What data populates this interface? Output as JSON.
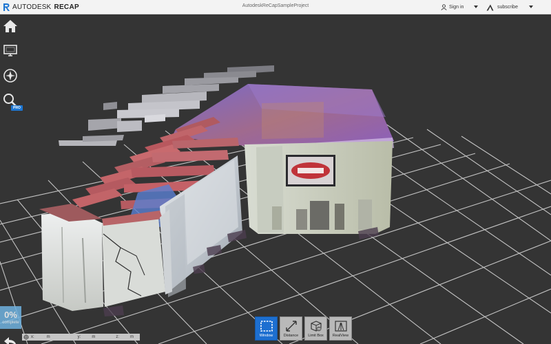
{
  "app": {
    "brand_prefix": "AUTODESK",
    "brand_product": "RECAP",
    "window_title": "AutodeskReCapSampleProject"
  },
  "header": {
    "sign_in_label": "Sign in",
    "subscribe_label": "subscribe"
  },
  "left_toolbar": {
    "items": [
      {
        "icon": "home-icon"
      },
      {
        "icon": "monitor-icon"
      },
      {
        "icon": "navigation-wheel-icon"
      },
      {
        "icon": "search-icon"
      }
    ],
    "pro_badge": "PRO"
  },
  "progress": {
    "value": "0%",
    "label": "complete"
  },
  "coordinates": {
    "x_label": "x:",
    "x_unit": "m",
    "y_label": "y:",
    "y_unit": "m",
    "z_label": "z:",
    "z_unit": "m"
  },
  "bottom_toolbar": {
    "tools": [
      {
        "label": "Window",
        "icon": "window-select-icon",
        "active": true
      },
      {
        "label": "Distance",
        "icon": "distance-measure-icon",
        "active": false
      },
      {
        "label": "Limit Box",
        "icon": "limit-box-icon",
        "active": false
      },
      {
        "label": "RealView",
        "icon": "realview-icon",
        "active": false
      }
    ]
  },
  "colors": {
    "viewport_bg": "#343434",
    "active_tool": "#1d6fd0",
    "progress_bg": "#6fb2e0",
    "brand_accent": "#1d76d2"
  }
}
